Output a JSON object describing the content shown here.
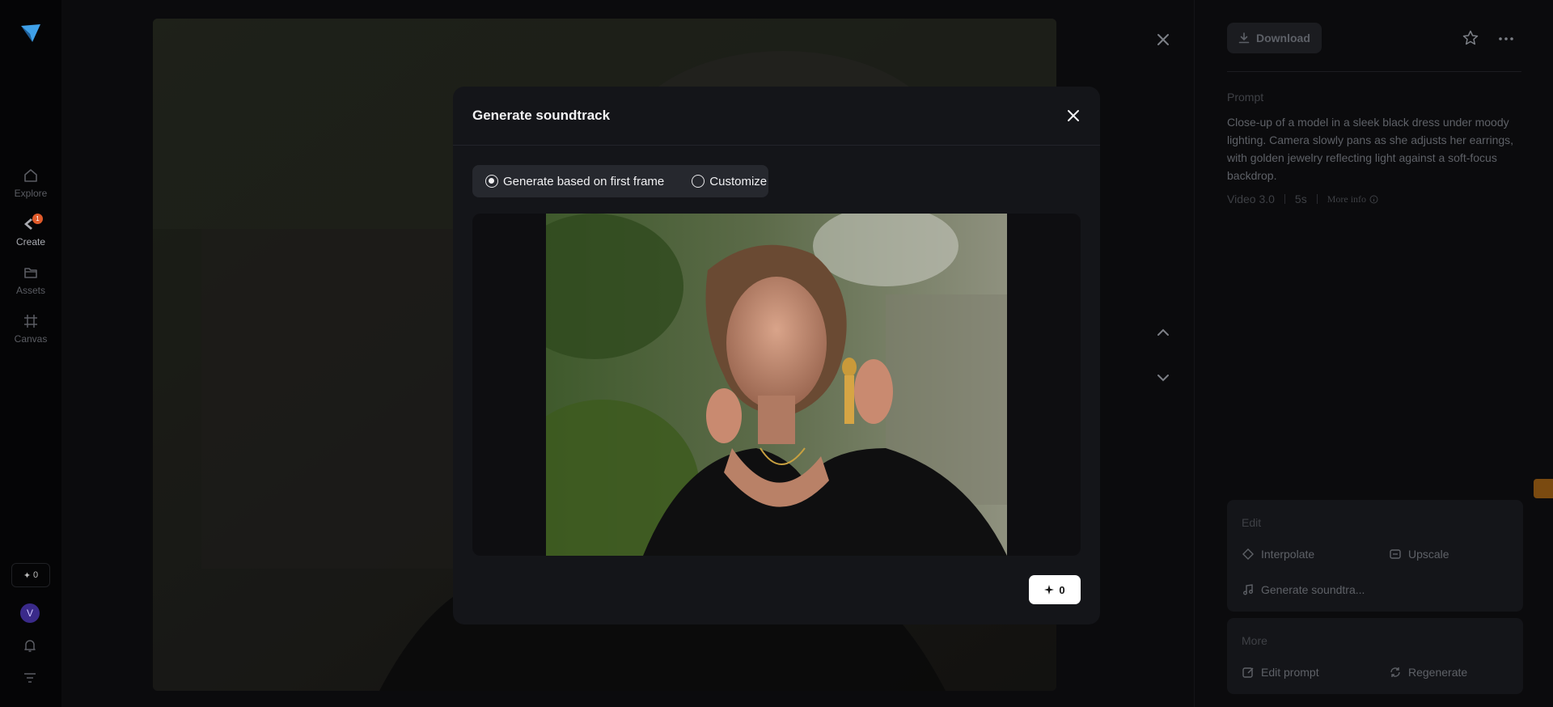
{
  "nav": {
    "items": [
      {
        "label": "Explore",
        "icon": "home-icon"
      },
      {
        "label": "Create",
        "icon": "create-icon",
        "badge": "1"
      },
      {
        "label": "Assets",
        "icon": "folder-icon"
      },
      {
        "label": "Canvas",
        "icon": "canvas-icon"
      }
    ],
    "credits": "0",
    "avatar_initial": "V"
  },
  "right_panel": {
    "download_label": "Download",
    "prompt_label": "Prompt",
    "prompt_text": "Close-up of a model in a sleek black dress under moody lighting. Camera slowly pans as she adjusts her earrings, with golden jewelry reflecting light against a soft-focus backdrop.",
    "meta": {
      "model": "Video 3.0",
      "duration": "5s",
      "more_info": "More info"
    },
    "edit": {
      "title": "Edit",
      "interpolate": "Interpolate",
      "upscale": "Upscale",
      "soundtrack": "Generate soundtra..."
    },
    "more": {
      "title": "More",
      "edit_prompt": "Edit prompt",
      "regenerate": "Regenerate"
    }
  },
  "modal": {
    "title": "Generate soundtrack",
    "option_first_frame": "Generate based on first frame",
    "option_customize": "Customize",
    "selected_option": "first_frame",
    "generate_cost": "0"
  },
  "colors": {
    "accent_badge": "#e05a2a",
    "modal_bg": "#141519",
    "button_primary": "#ffffff"
  }
}
